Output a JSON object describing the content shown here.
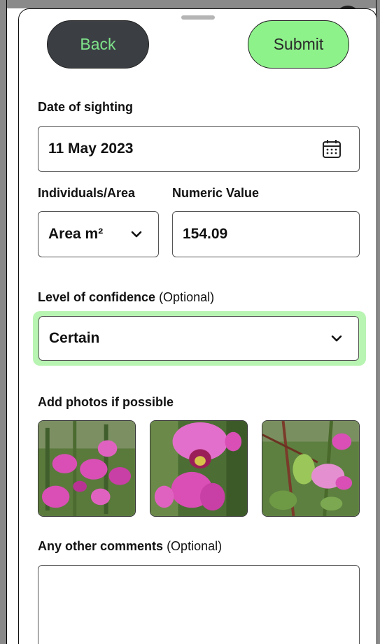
{
  "buttons": {
    "back_label": "Back",
    "submit_label": "Submit"
  },
  "date": {
    "label": "Date of sighting",
    "value": "11 May 2023",
    "icon": "calendar-icon"
  },
  "measure": {
    "unit_label": "Individuals/Area",
    "unit_value": "Area m²",
    "value_label": "Numeric Value",
    "value": "154.09"
  },
  "confidence": {
    "label": "Level of confidence",
    "optional": "(Optional)",
    "value": "Certain"
  },
  "photos": {
    "label": "Add photos if possible",
    "items": [
      "flower-photo-1",
      "flower-photo-2",
      "flower-photo-3"
    ]
  },
  "comments": {
    "label": "Any other comments",
    "optional": "(Optional)",
    "value": ""
  },
  "colors": {
    "accent_green": "#8ef28b",
    "focus_ring": "#b8f4b2",
    "back_button": "#3b3f44",
    "flower_pink": "#d94fb5"
  }
}
